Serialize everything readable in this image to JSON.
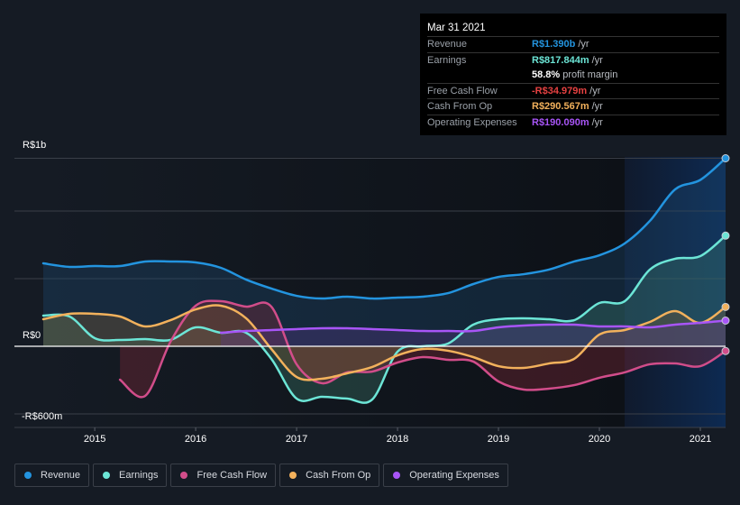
{
  "tooltip": {
    "date": "Mar 31 2021",
    "rows": [
      {
        "label": "Revenue",
        "value": "R$1.390b",
        "unit": "/yr",
        "color": "#2394df"
      },
      {
        "label": "Earnings",
        "value": "R$817.844m",
        "unit": "/yr",
        "color": "#6ce5d6"
      },
      {
        "label": "",
        "value": "58.8%",
        "unit": "profit margin",
        "color": "#ffffff"
      },
      {
        "label": "Free Cash Flow",
        "value": "-R$34.979m",
        "unit": "/yr",
        "color": "#e64141"
      },
      {
        "label": "Cash From Op",
        "value": "R$290.567m",
        "unit": "/yr",
        "color": "#f2b15c"
      },
      {
        "label": "Operating Expenses",
        "value": "R$190.090m",
        "unit": "/yr",
        "color": "#a855f7"
      }
    ]
  },
  "chart_data": {
    "type": "line",
    "title": "",
    "xlabel": "",
    "ylabel": "",
    "y_tick_labels": [
      "R$1b",
      "R$0",
      "-R$600m"
    ],
    "y_ticks": [
      1000,
      0,
      -600
    ],
    "gridlines_m": [
      1390,
      1000,
      500,
      0,
      -500
    ],
    "ylim": [
      -600,
      1390
    ],
    "x_tick_labels": [
      "2015",
      "2016",
      "2017",
      "2018",
      "2019",
      "2020",
      "2021"
    ],
    "xlim": [
      2014.49,
      2021.25
    ],
    "highlight_from": 2020.25,
    "grid": true,
    "legend_position": "bottom-left",
    "x": [
      2014.49,
      2014.75,
      2015.0,
      2015.25,
      2015.5,
      2015.75,
      2016.0,
      2016.25,
      2016.5,
      2016.75,
      2017.0,
      2017.25,
      2017.5,
      2017.75,
      2018.0,
      2018.25,
      2018.5,
      2018.75,
      2019.0,
      2019.25,
      2019.5,
      2019.75,
      2020.0,
      2020.25,
      2020.5,
      2020.75,
      2021.0,
      2021.25
    ],
    "series": [
      {
        "name": "Revenue",
        "color": "#2394df",
        "values": [
          613,
          587,
          593,
          593,
          627,
          627,
          620,
          580,
          493,
          427,
          373,
          353,
          367,
          353,
          360,
          367,
          393,
          460,
          513,
          533,
          567,
          627,
          673,
          760,
          927,
          1160,
          1230,
          1390
        ]
      },
      {
        "name": "Earnings",
        "color": "#6ce5d6",
        "values": [
          227,
          220,
          60,
          47,
          53,
          47,
          140,
          100,
          100,
          -93,
          -387,
          -373,
          -387,
          -393,
          -40,
          0,
          20,
          160,
          200,
          207,
          200,
          193,
          320,
          333,
          567,
          647,
          667,
          818
        ]
      },
      {
        "name": "Free Cash Flow",
        "color": "#d14d8a",
        "values": [
          null,
          null,
          null,
          -247,
          -367,
          33,
          300,
          333,
          293,
          293,
          -133,
          -273,
          -193,
          -187,
          -120,
          -80,
          -100,
          -113,
          -260,
          -320,
          -313,
          -287,
          -233,
          -193,
          -133,
          -127,
          -147,
          -35
        ]
      },
      {
        "name": "Cash From Op",
        "color": "#f2b15c",
        "values": [
          200,
          240,
          240,
          220,
          147,
          193,
          273,
          300,
          207,
          -20,
          -227,
          -240,
          -200,
          -153,
          -67,
          -20,
          -33,
          -80,
          -147,
          -160,
          -127,
          -93,
          87,
          120,
          180,
          260,
          173,
          291
        ]
      },
      {
        "name": "Operating Expenses",
        "color": "#a855f7",
        "values": [
          null,
          null,
          null,
          null,
          null,
          null,
          null,
          100,
          113,
          120,
          127,
          133,
          133,
          127,
          120,
          113,
          113,
          113,
          140,
          153,
          160,
          160,
          147,
          147,
          140,
          160,
          173,
          190
        ]
      }
    ]
  },
  "legend": [
    {
      "label": "Revenue",
      "color": "#2394df"
    },
    {
      "label": "Earnings",
      "color": "#6ce5d6"
    },
    {
      "label": "Free Cash Flow",
      "color": "#d14d8a"
    },
    {
      "label": "Cash From Op",
      "color": "#f2b15c"
    },
    {
      "label": "Operating Expenses",
      "color": "#a855f7"
    }
  ]
}
